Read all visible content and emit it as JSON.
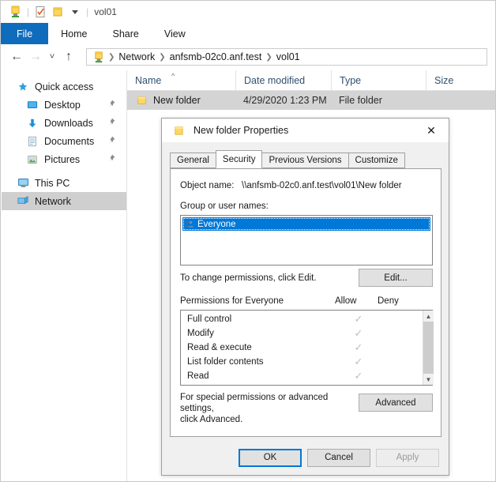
{
  "window": {
    "title": "vol01",
    "quick_access_toolbar": [
      {
        "icon": "network-folder-icon",
        "name": "network-folder"
      },
      {
        "icon": "properties-icon",
        "name": "properties"
      },
      {
        "icon": "new-folder-icon",
        "name": "new-folder"
      },
      {
        "icon": "chevron-down-icon",
        "name": "customize-qat"
      }
    ]
  },
  "ribbon": {
    "tabs": [
      {
        "label": "File",
        "active": true
      },
      {
        "label": "Home",
        "active": false
      },
      {
        "label": "Share",
        "active": false
      },
      {
        "label": "View",
        "active": false
      }
    ]
  },
  "address_bar": {
    "back": "back-icon",
    "forward": "forward-icon",
    "recent": "chevron-down-icon",
    "up": "up-icon",
    "breadcrumbs": [
      "Network",
      "anfsmb-02c0.anf.test",
      "vol01"
    ]
  },
  "sidebar": {
    "items": [
      {
        "label": "Quick access",
        "icon": "star-icon",
        "pinned": false,
        "child": false,
        "selected": false
      },
      {
        "label": "Desktop",
        "icon": "desktop-icon",
        "pinned": true,
        "child": true,
        "selected": false
      },
      {
        "label": "Downloads",
        "icon": "download-icon",
        "pinned": true,
        "child": true,
        "selected": false
      },
      {
        "label": "Documents",
        "icon": "document-icon",
        "pinned": true,
        "child": true,
        "selected": false
      },
      {
        "label": "Pictures",
        "icon": "picture-icon",
        "pinned": true,
        "child": true,
        "selected": false
      },
      {
        "label": "This PC",
        "icon": "computer-icon",
        "pinned": false,
        "child": false,
        "selected": false
      },
      {
        "label": "Network",
        "icon": "network-icon",
        "pinned": false,
        "child": false,
        "selected": true
      }
    ]
  },
  "file_list": {
    "columns": [
      "Name",
      "Date modified",
      "Type",
      "Size"
    ],
    "sorted_by": "Name",
    "rows": [
      {
        "name": "New folder",
        "date_modified": "4/29/2020 1:23 PM",
        "type": "File folder",
        "size": "",
        "selected": true
      }
    ]
  },
  "dialog": {
    "title": "New folder Properties",
    "close_label": "✕",
    "tabs": [
      {
        "label": "General",
        "active": false
      },
      {
        "label": "Security",
        "active": true
      },
      {
        "label": "Previous Versions",
        "active": false
      },
      {
        "label": "Customize",
        "active": false
      }
    ],
    "object_name_label": "Object name:",
    "object_name_value": "\\\\anfsmb-02c0.anf.test\\vol01\\New folder",
    "group_label": "Group or user names:",
    "group_items": [
      {
        "name": "Everyone",
        "icon": "users-icon",
        "selected": true
      }
    ],
    "change_hint": "To change permissions, click Edit.",
    "edit_button": "Edit...",
    "permissions_header": "Permissions for Everyone",
    "allow_header": "Allow",
    "deny_header": "Deny",
    "permissions": [
      {
        "name": "Full control",
        "allow": true,
        "deny": false
      },
      {
        "name": "Modify",
        "allow": true,
        "deny": false
      },
      {
        "name": "Read & execute",
        "allow": true,
        "deny": false
      },
      {
        "name": "List folder contents",
        "allow": true,
        "deny": false
      },
      {
        "name": "Read",
        "allow": true,
        "deny": false
      }
    ],
    "check_glyph": "✓",
    "advanced_hint_line1": "For special permissions or advanced settings,",
    "advanced_hint_line2": "click Advanced.",
    "advanced_button": "Advanced",
    "footer_buttons": [
      {
        "label": "OK",
        "state": "default"
      },
      {
        "label": "Cancel",
        "state": "normal"
      },
      {
        "label": "Apply",
        "state": "disabled"
      }
    ]
  },
  "colors": {
    "accent": "#0078d7",
    "file_tab": "#0f6cbd",
    "selection": "#d4d4d4",
    "folder_yellow": "#ffd75e"
  }
}
